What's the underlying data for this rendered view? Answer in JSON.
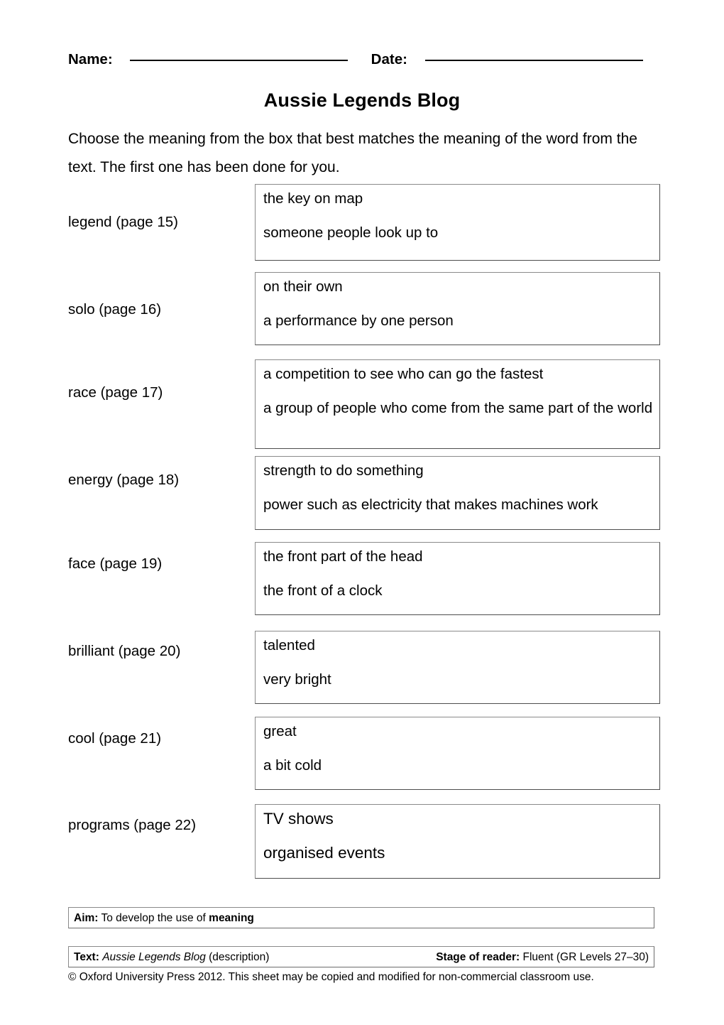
{
  "header": {
    "name_label": "Name:",
    "date_label": "Date:"
  },
  "title": "Aussie Legends Blog",
  "instructions": "Choose the meaning from the box that best matches the meaning of the word from the text. The first one has been done for you.",
  "circle_color": "#29ABE2",
  "items": [
    {
      "word": "legend (page 15)",
      "choices": [
        "the key on map",
        "someone people look up to"
      ],
      "circled_index": 1
    },
    {
      "word": "solo (page 16)",
      "choices": [
        "on their own",
        "a performance by one person"
      ],
      "circled_index": -1
    },
    {
      "word": "race (page 17)",
      "choices": [
        "a competition to see who can go the fastest",
        "a group of people who come from the same part of the world"
      ],
      "circled_index": -1
    },
    {
      "word": "energy (page 18)",
      "choices": [
        "strength to do something",
        "power such as electricity that makes machines work"
      ],
      "circled_index": -1
    },
    {
      "word": "face (page 19)",
      "choices": [
        "the front part of the head",
        "the front of a clock"
      ],
      "circled_index": -1
    },
    {
      "word": "brilliant (page 20)",
      "choices": [
        "talented",
        "very bright"
      ],
      "circled_index": -1
    },
    {
      "word": "cool (page 21)",
      "choices": [
        "great",
        "a bit cold"
      ],
      "circled_index": -1
    },
    {
      "word": "programs (page 22)",
      "choices": [
        "TV shows",
        "organised events"
      ],
      "circled_index": -1
    }
  ],
  "aim": {
    "label": "Aim:",
    "text": " To develop the use of ",
    "emphasis": "meaning"
  },
  "text_info": {
    "text_label": "Text:",
    "text_title": "Aussie Legends Blog",
    "text_suffix": " (description)",
    "stage_label": "Stage of reader:",
    "stage_value": " Fluent (GR Levels 27–30)"
  },
  "copyright": "© Oxford University Press 2012. This sheet may be copied and modified for non-commercial classroom use."
}
